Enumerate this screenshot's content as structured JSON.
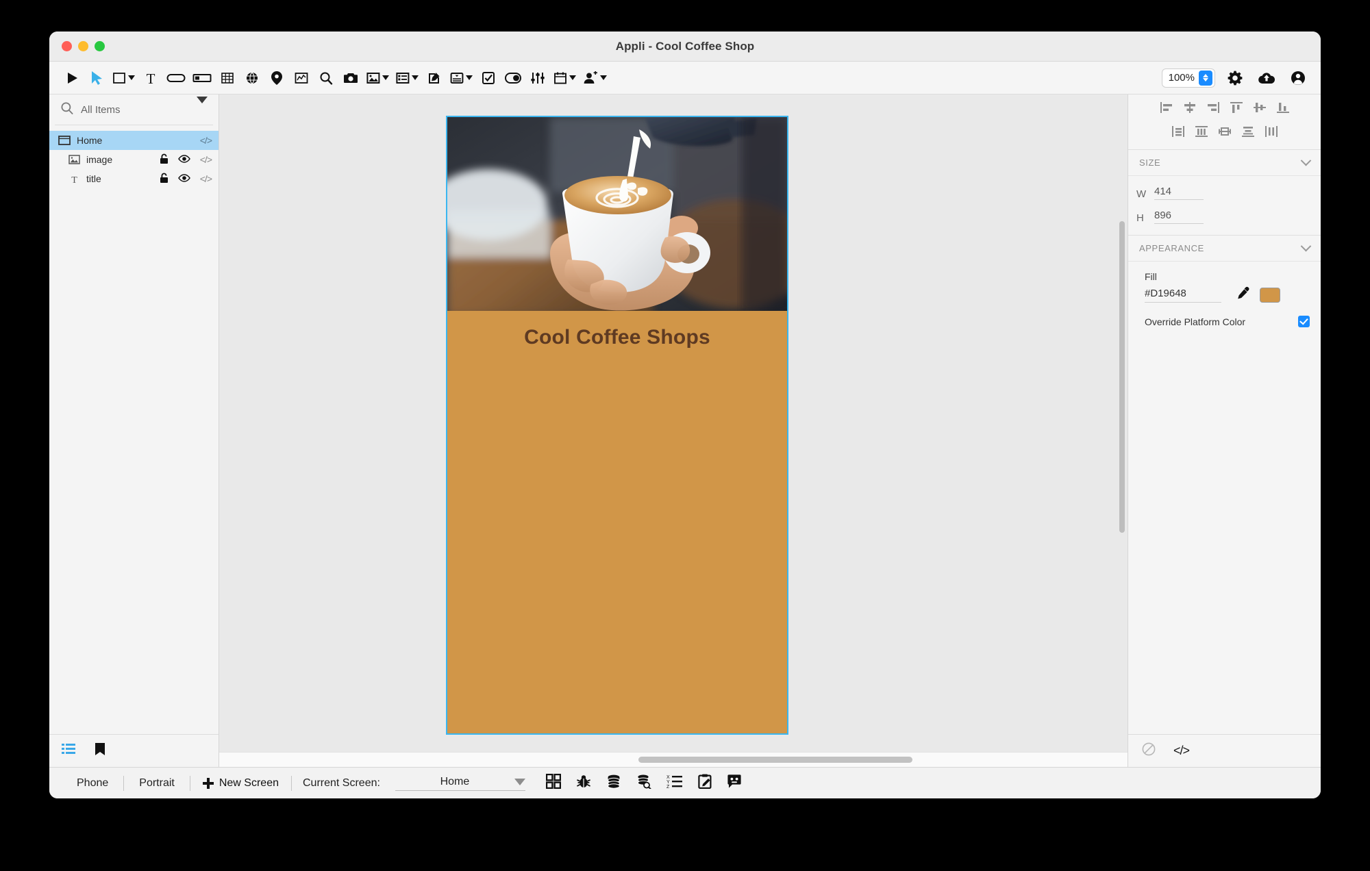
{
  "window": {
    "title": "Appli - Cool Coffee Shop",
    "traffic_lights": [
      "close",
      "minimize",
      "maximize"
    ]
  },
  "toolbar": {
    "left_tools": [
      {
        "name": "play-icon",
        "label": "Preview"
      },
      {
        "name": "cursor-select-icon",
        "label": "Select"
      },
      {
        "name": "rectangle-shape-icon",
        "label": "Shape",
        "has_menu": true
      },
      {
        "name": "text-tool-icon",
        "label": "Text"
      },
      {
        "name": "button-icon",
        "label": "Button"
      },
      {
        "name": "text-field-icon",
        "label": "Text Field"
      },
      {
        "name": "table-icon",
        "label": "Table"
      },
      {
        "name": "web-view-icon",
        "label": "Web View"
      },
      {
        "name": "map-pin-icon",
        "label": "Map"
      },
      {
        "name": "chart-icon",
        "label": "Chart"
      },
      {
        "name": "search-icon",
        "label": "Search"
      },
      {
        "name": "camera-icon",
        "label": "Camera"
      },
      {
        "name": "image-icon",
        "label": "Image",
        "has_menu": true
      },
      {
        "name": "list-view-icon",
        "label": "List",
        "has_menu": true
      },
      {
        "name": "edit-note-icon",
        "label": "Edit"
      },
      {
        "name": "picker-icon",
        "label": "Picker",
        "has_menu": true
      },
      {
        "name": "checkbox-icon",
        "label": "Checkbox"
      },
      {
        "name": "toggle-switch-icon",
        "label": "Switch"
      },
      {
        "name": "sliders-icon",
        "label": "Sliders"
      },
      {
        "name": "calendar-icon",
        "label": "Date Picker",
        "has_menu": true
      },
      {
        "name": "add-user-icon",
        "label": "User",
        "has_menu": true
      }
    ],
    "zoom": {
      "value": "100%"
    },
    "right_tools": [
      {
        "name": "gear-icon",
        "label": "Settings"
      },
      {
        "name": "cloud-upload-icon",
        "label": "Publish"
      },
      {
        "name": "account-icon",
        "label": "Account"
      }
    ]
  },
  "sidebar": {
    "search": {
      "placeholder": "All Items",
      "value": "All Items"
    },
    "filter_caret": "chevron-down-icon",
    "items": [
      {
        "label": "Home",
        "icon": "screen-icon",
        "selected": true,
        "indent": 0,
        "lock": false,
        "eye": false,
        "code": true
      },
      {
        "label": "image",
        "icon": "image-layer-icon",
        "selected": false,
        "indent": 1,
        "lock": true,
        "eye": true,
        "code": true
      },
      {
        "label": "title",
        "icon": "text-layer-icon",
        "selected": false,
        "indent": 1,
        "lock": true,
        "eye": true,
        "code": true
      }
    ],
    "footer_icons": [
      {
        "name": "layers-list-icon",
        "active": true
      },
      {
        "name": "bookmark-icon",
        "active": false
      }
    ]
  },
  "canvas": {
    "screen": {
      "title_text": "Cool Coffee Shops",
      "fill_color": "#D19648",
      "title_color": "#5E3A22",
      "image_alt": "barista pouring milk into latte cup"
    }
  },
  "inspector": {
    "align_icons_row1": [
      "align-left-icon",
      "align-center-horizontal-icon",
      "align-right-icon",
      "align-top-icon",
      "align-middle-vertical-icon",
      "align-bottom-icon"
    ],
    "align_icons_row2": [
      "distribute-left-icon",
      "distribute-horizontal-icon",
      "distribute-center-icon",
      "distribute-vertical-icon",
      "distribute-spacing-icon"
    ],
    "size": {
      "header": "SIZE",
      "width_label": "W",
      "width_value": "414",
      "height_label": "H",
      "height_value": "896"
    },
    "appearance": {
      "header": "APPEARANCE",
      "fill_label": "Fill",
      "fill_value": "#D19648",
      "eyedropper": "eyedropper-icon",
      "swatch_color": "#D19648",
      "override_label": "Override Platform Color",
      "override_checked": true
    },
    "footer_icons": [
      {
        "name": "no-entry-icon"
      },
      {
        "name": "code-brackets-icon"
      }
    ]
  },
  "statusbar": {
    "device": "Phone",
    "orientation": "Portrait",
    "new_screen": "New Screen",
    "current_screen_label": "Current Screen:",
    "current_screen_value": "Home",
    "icons": [
      {
        "name": "grid-view-icon"
      },
      {
        "name": "debug-bug-icon"
      },
      {
        "name": "database-icon"
      },
      {
        "name": "database-search-icon"
      },
      {
        "name": "sort-xyz-icon"
      },
      {
        "name": "clipboard-edit-icon"
      },
      {
        "name": "chatbot-icon"
      }
    ]
  }
}
